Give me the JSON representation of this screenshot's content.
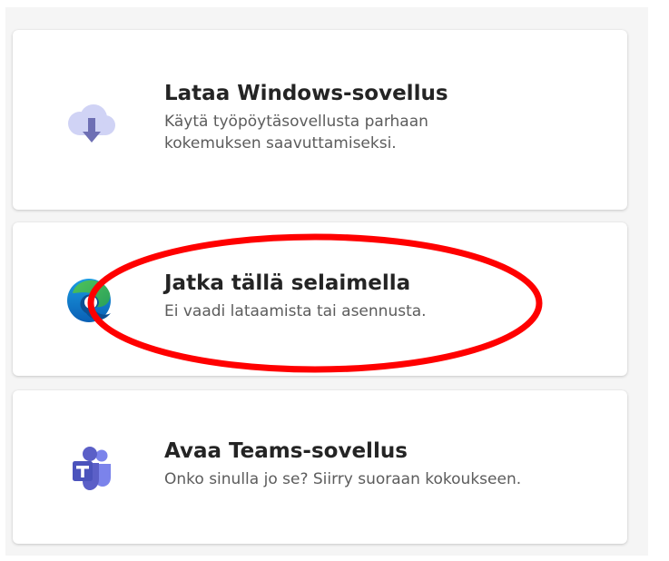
{
  "options": [
    {
      "title": "Lataa Windows-sovellus",
      "description_lines": [
        "Käytä työpöytäsovellusta parhaan",
        "kokemuksen saavuttamiseksi."
      ],
      "icon": "cloud-download-icon"
    },
    {
      "title": "Jatka tällä selaimella",
      "description_lines": [
        "Ei vaadi lataamista tai asennusta."
      ],
      "icon": "edge-browser-icon"
    },
    {
      "title": "Avaa Teams-sovellus",
      "description_lines": [
        "Onko sinulla jo se? Siirry suoraan kokoukseen."
      ],
      "icon": "teams-icon"
    }
  ],
  "colors": {
    "panel_background": "#f5f5f5",
    "card_background": "#ffffff",
    "title_text": "#242424",
    "description_text": "#5c5c5c",
    "cloud_fill": "#d0d3f5",
    "download_arrow": "#6e6fb4",
    "teams_purple": "#5b5fc7",
    "annotation_red": "#ff0000"
  },
  "annotation": {
    "shape": "ellipse",
    "highlights": "Jatka tällä selaimella"
  }
}
